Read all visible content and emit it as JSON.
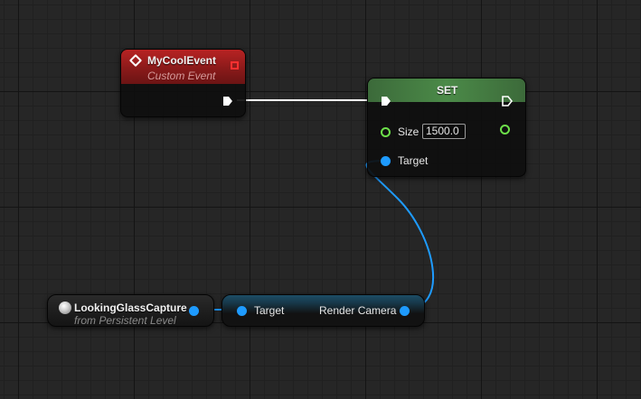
{
  "colors": {
    "exec_wire": "#ffffff",
    "object_pin": "#1e9bff",
    "float_pin": "#6de04a",
    "event_header": "#9e1e1e",
    "set_header": "#4b8a48"
  },
  "event_node": {
    "title": "MyCoolEvent",
    "subtitle": "Custom Event",
    "icon": "event-diamond-icon"
  },
  "set_node": {
    "title": "SET",
    "pins": {
      "size_label": "Size",
      "size_value": "1500.0",
      "target_label": "Target"
    }
  },
  "variable_node": {
    "title": "LookingGlassCapture",
    "subtitle": "from Persistent Level",
    "icon": "level-actor-icon"
  },
  "getter_node": {
    "target_label": "Target",
    "output_label": "Render Camera"
  }
}
